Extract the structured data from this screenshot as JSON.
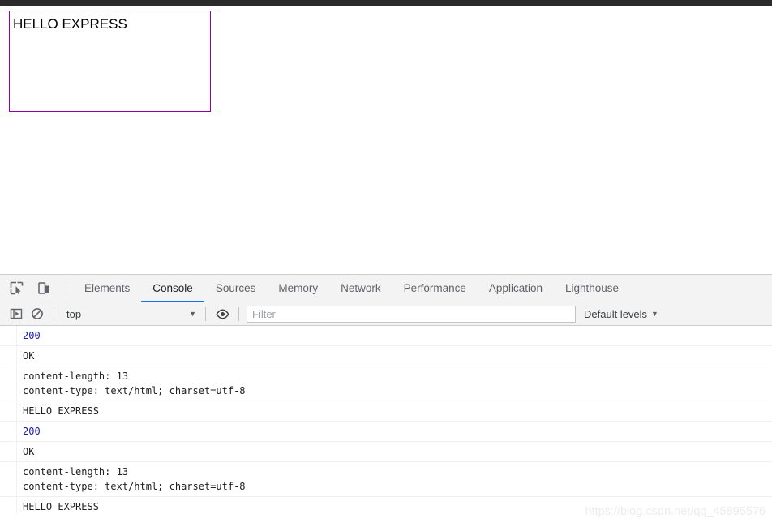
{
  "page": {
    "box_text": "HELLO EXPRESS",
    "box_border_color": "#9400a8"
  },
  "devtools": {
    "toolbar_icons": [
      {
        "name": "inspect-element-icon",
        "title": "Inspect element"
      },
      {
        "name": "device-toolbar-icon",
        "title": "Toggle device toolbar"
      }
    ],
    "tabs": [
      {
        "label": "Elements",
        "active": false
      },
      {
        "label": "Console",
        "active": true
      },
      {
        "label": "Sources",
        "active": false
      },
      {
        "label": "Memory",
        "active": false
      },
      {
        "label": "Network",
        "active": false
      },
      {
        "label": "Performance",
        "active": false
      },
      {
        "label": "Application",
        "active": false
      },
      {
        "label": "Lighthouse",
        "active": false
      }
    ],
    "active_tab_underline_color": "#1a73e8",
    "console_toolbar": {
      "sidebar_toggle_icon": "console-sidebar-icon",
      "clear_icon": "clear-console-icon",
      "context": "top",
      "context_caret": "▼",
      "eye_icon": "live-expression-eye-icon",
      "filter_value": "",
      "filter_placeholder": "Filter",
      "levels_label": "Default levels",
      "levels_caret": "▼"
    },
    "messages": [
      {
        "text": "200",
        "kind": "number"
      },
      {
        "text": "OK",
        "kind": "text"
      },
      {
        "text": "content-length: 13\ncontent-type: text/html; charset=utf-8",
        "kind": "text"
      },
      {
        "text": "HELLO EXPRESS",
        "kind": "text"
      },
      {
        "text": "200",
        "kind": "number"
      },
      {
        "text": "OK",
        "kind": "text"
      },
      {
        "text": "content-length: 13\ncontent-type: text/html; charset=utf-8",
        "kind": "text"
      },
      {
        "text": "HELLO EXPRESS",
        "kind": "text"
      }
    ]
  },
  "watermark": "https://blog.csdn.net/qq_45895576"
}
